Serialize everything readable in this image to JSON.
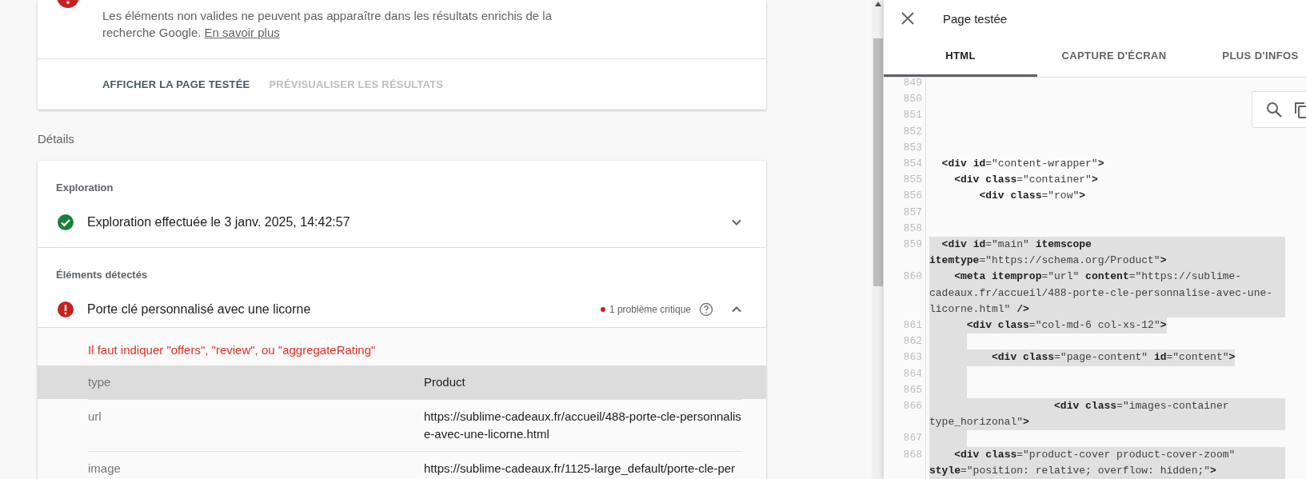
{
  "result_card": {
    "kind": "error",
    "message": "Les éléments non valides ne peuvent pas apparaître dans les résultats enrichis de la recherche Google.",
    "link": "En savoir plus",
    "actions": [
      {
        "label": "AFFICHER LA PAGE TESTÉE",
        "disabled": false
      },
      {
        "label": "PRÉVISUALISER LES RÉSULTATS",
        "disabled": true
      }
    ]
  },
  "details": {
    "heading": "Détails",
    "sections": [
      {
        "title": "Exploration",
        "items": [
          {
            "kind": "ok",
            "label": "Exploration effectuée le 3 janv. 2025, 14:42:57",
            "expanded": false
          }
        ]
      },
      {
        "title": "Éléments détectés",
        "items": [
          {
            "kind": "error",
            "label": "Porte clé personnalisé avec une licorne",
            "issue": "1 problème critique",
            "expanded": true,
            "error": "Il faut indiquer \"offers\", \"review\", ou \"aggregateRating\"",
            "properties": [
              {
                "name": "type",
                "value": "Product",
                "selected": true
              },
              {
                "name": "url",
                "value": "https://sublime-cadeaux.fr/accueil/488-porte-cle-personnalise-avec-une-licorne.html",
                "selected": false
              },
              {
                "name": "image",
                "value": "https://sublime-cadeaux.fr/1125-large_default/porte-cle-per",
                "selected": false
              }
            ]
          }
        ]
      }
    ]
  },
  "panel": {
    "title": "Page testée",
    "tabs": [
      {
        "label": "HTML",
        "selected": true
      },
      {
        "label": "CAPTURE D'ÉCRAN",
        "selected": false
      },
      {
        "label": "PLUS D'INFOS",
        "selected": false
      }
    ],
    "code_lines": [
      {
        "number": "849",
        "selected": false
      },
      {
        "number": "850",
        "selected": false
      },
      {
        "number": "851",
        "selected": false
      },
      {
        "number": "852",
        "selected": false
      },
      {
        "number": "853",
        "selected": false
      },
      {
        "number": "854",
        "text": "  **<div** **id**=\"content-wrapper\"**>**",
        "selected": false
      },
      {
        "number": "855",
        "text": "    **<div** **class**=\"container\"**>**",
        "selected": false
      },
      {
        "number": "856",
        "text": "        **<div** **class**=\"row\"**>**",
        "selected": false
      },
      {
        "number": "857",
        "selected": false
      },
      {
        "number": "858",
        "selected": false
      },
      {
        "number": "859",
        "text": "  **<div** **id**=\"main\" **itemscope** **itemtype**=\"https://schema.org/Product\"**>**",
        "selected": true
      },
      {
        "number": "860",
        "text": "    **<meta** **itemprop**=\"url\" **content**=\"https://sublime-cadeaux.fr/accueil/488-porte-cle-personnalise-avec-une-licorne.html\" **/>**",
        "selected": true
      },
      {
        "number": "861",
        "text": "      **<div** **class**=\"col-md-6 col-xs-12\"**>**",
        "selected": true
      },
      {
        "number": "862",
        "selected": true
      },
      {
        "number": "863",
        "text": "          **<div** **class**=\"page-content\" **id**=\"content\"**>**",
        "selected": true
      },
      {
        "number": "864",
        "selected": true
      },
      {
        "number": "865",
        "selected": true
      },
      {
        "number": "866",
        "text": "                    **<div** **class**=\"images-container type_horizonal\"**>**",
        "selected": true
      },
      {
        "number": "867",
        "selected": true
      },
      {
        "number": "868",
        "text": "    **<div** **class**=\"product-cover product-cover-zoom\" **style**=\"position: relative; overflow: hidden;\"**>**",
        "selected": true
      }
    ]
  }
}
